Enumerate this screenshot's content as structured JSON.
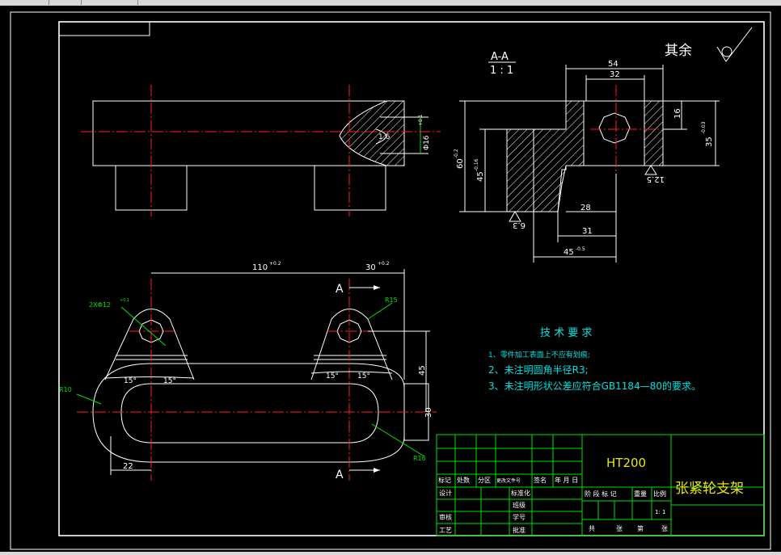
{
  "section": {
    "label": "A-A",
    "scale": "1 : 1"
  },
  "finish": {
    "label": "其余"
  },
  "dims_section": {
    "d54": "54",
    "d32": "32",
    "d16": "16",
    "d35": "35",
    "d35_tol": "-0.03",
    "d60": "60",
    "d60_tol": "-0.2",
    "d45": "45",
    "d45_tol": "-0.16",
    "d28": "28",
    "d31": "31",
    "d45b": "45",
    "d45b_tol": "-0.5",
    "rough125": "12.5",
    "rough63": "6.3"
  },
  "dims_top": {
    "hole": "Φ16",
    "hole_tol": "+0.1",
    "r16": "1.6"
  },
  "dims_plan": {
    "d110": "110",
    "d110_tol": "+0.2",
    "d30": "30",
    "d30_tol": "+0.2",
    "holes": "2XΦ12",
    "holes_tol": "+0.1",
    "r15": "R15",
    "r10": "R10",
    "r16": "R16",
    "ang1": "15°",
    "ang2": "15°",
    "ang3": "15°",
    "ang4": "15°",
    "d45": "45",
    "d30v": "30",
    "d22": "22",
    "arrowA": "A"
  },
  "tech": {
    "title": "技 术 要 求",
    "items": [
      "1、零件加工表面上不应有划痕;",
      "2、未注明圆角半径R3;",
      "3、未注明形状公差应符合GB1184—80的要求。"
    ]
  },
  "titleblock": {
    "material": "HT200",
    "part_name": "张紧轮支架",
    "cells": {
      "biaoji": "标记",
      "chushu": "处数",
      "fenqu": "分区",
      "gengwen": "更改文件号",
      "qianming": "签名",
      "nianyueri": "年 月 日",
      "sheji": "设计",
      "biaozhunhua": "标准化",
      "banji": "班级",
      "shenhe": "审核",
      "xuehao": "学号",
      "gongyi": "工艺",
      "pizhun": "批准",
      "jieduan": "阶 段 标 记",
      "zhongliang": "重量",
      "bili": "比例",
      "scale": "1: 1",
      "gong": "共",
      "zhang1": "张",
      "di": "第",
      "zhang2": "张"
    }
  },
  "colors": {
    "bg": "#000000",
    "line": "#ffffff",
    "center": "#ff2020",
    "frame": "#00e000",
    "dim": "#00e0e0",
    "note": "#e8e800"
  }
}
